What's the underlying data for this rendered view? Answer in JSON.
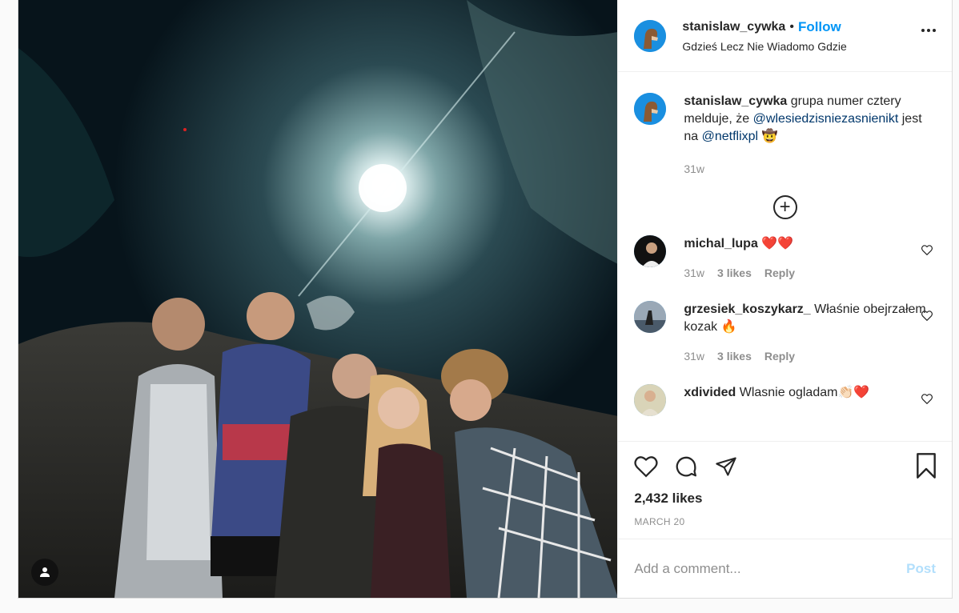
{
  "header": {
    "username": "stanislaw_cywka",
    "separator": "•",
    "follow_label": "Follow",
    "location": "Gdzieś Lecz Nie Wiadomo Gdzie"
  },
  "caption": {
    "username": "stanislaw_cywka",
    "text1": "grupa numer cztery melduje, że",
    "mention1": "@wlesiedzisniezasnienikt",
    "text2": "jest na",
    "mention2": "@netflixpl",
    "emoji": "🤠",
    "time": "31w"
  },
  "comments": [
    {
      "username": "michal_lupa",
      "text": "❤️❤️",
      "time": "31w",
      "likes": "3 likes",
      "reply": "Reply"
    },
    {
      "username": "grzesiek_koszykarz_",
      "text": "Właśnie obejrzałem kozak 🔥",
      "time": "31w",
      "likes": "3 likes",
      "reply": "Reply"
    },
    {
      "username": "xdivided",
      "text": "Wlasnie ogladam👏🏻❤️"
    }
  ],
  "likes": "2,432 likes",
  "date": "MARCH 20",
  "add_comment": {
    "placeholder": "Add a comment...",
    "post_label": "Post"
  },
  "colors": {
    "accent": "#0095f6",
    "post_disabled": "#b2dffc",
    "mention": "#00376b"
  }
}
